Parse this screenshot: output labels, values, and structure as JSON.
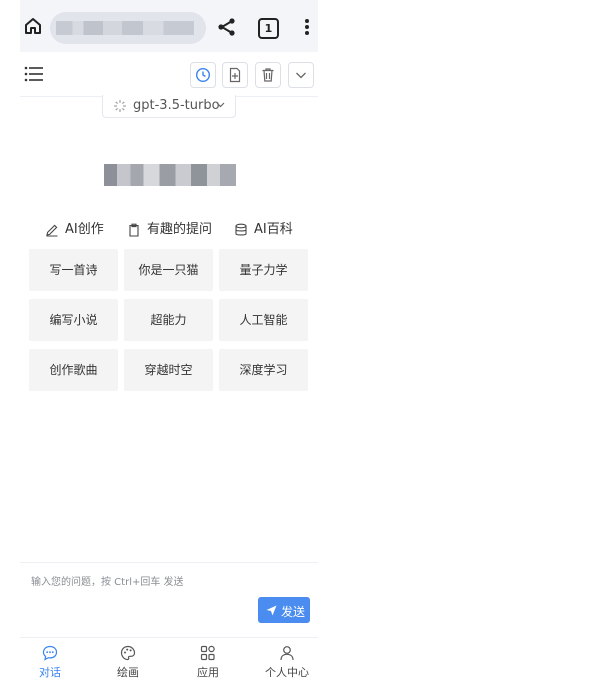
{
  "browser": {
    "tab_count": "1"
  },
  "model": {
    "name": "gpt-3.5-turbo"
  },
  "categories": [
    {
      "label": "AI创作",
      "icon": "pen-icon"
    },
    {
      "label": "有趣的提问",
      "icon": "clipboard-icon"
    },
    {
      "label": "AI百科",
      "icon": "database-icon"
    }
  ],
  "prompts": [
    [
      "写一首诗",
      "你是一只猫",
      "量子力学"
    ],
    [
      "编写小说",
      "超能力",
      "人工智能"
    ],
    [
      "创作歌曲",
      "穿越时空",
      "深度学习"
    ]
  ],
  "input": {
    "placeholder": "输入您的问题，按 Ctrl+回车 发送",
    "send_label": "发送"
  },
  "nav": [
    {
      "label": "对话",
      "icon": "chat-icon",
      "active": true
    },
    {
      "label": "绘画",
      "icon": "palette-icon",
      "active": false
    },
    {
      "label": "应用",
      "icon": "apps-icon",
      "active": false
    },
    {
      "label": "个人中心",
      "icon": "user-icon",
      "active": false
    }
  ],
  "colors": {
    "accent": "#4a8cf0",
    "active_nav": "#3a83f2",
    "tile_bg": "#f4f4f5"
  }
}
